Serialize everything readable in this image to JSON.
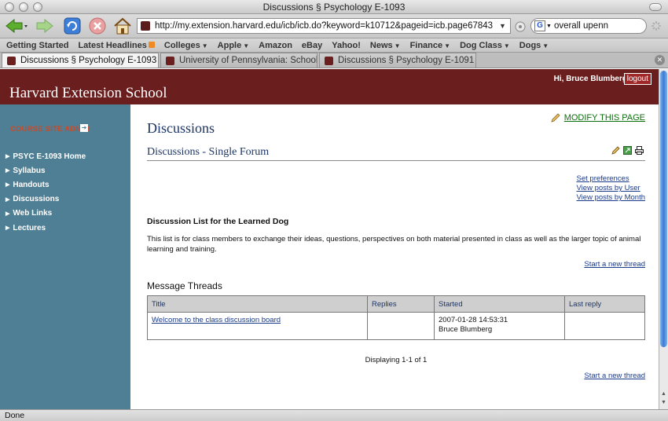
{
  "window": {
    "title": "Discussions § Psychology E-1093"
  },
  "navbar": {
    "url": "http://my.extension.harvard.edu/icb/icb.do?keyword=k10712&pageid=icb.page67843",
    "search_value": "overall upenn",
    "icons": [
      "back-icon",
      "forward-icon",
      "reload-icon",
      "stop-icon",
      "home-icon",
      "google-icon"
    ]
  },
  "bookmarks": [
    {
      "label": "Getting Started",
      "kind": "plain"
    },
    {
      "label": "Latest Headlines",
      "kind": "rss"
    },
    {
      "label": "Colleges",
      "kind": "menu"
    },
    {
      "label": "Apple",
      "kind": "menu"
    },
    {
      "label": "Amazon",
      "kind": "plain"
    },
    {
      "label": "eBay",
      "kind": "plain"
    },
    {
      "label": "Yahoo!",
      "kind": "plain"
    },
    {
      "label": "News",
      "kind": "menu"
    },
    {
      "label": "Finance",
      "kind": "menu"
    },
    {
      "label": "Dog Class",
      "kind": "menu"
    },
    {
      "label": "Dogs",
      "kind": "menu"
    }
  ],
  "tabs": [
    {
      "label": "Discussions § Psychology E-1093",
      "active": true
    },
    {
      "label": "University of Pennsylvania: School ...",
      "active": false
    },
    {
      "label": "Discussions § Psychology E-1091",
      "active": false
    }
  ],
  "header": {
    "school": "Harvard Extension School",
    "greeting": "Hi, Bruce Blumberg",
    "logout": "logout",
    "brand_color": "#6b1e1e"
  },
  "sidebar": {
    "admin_label": "COURSE SITE ADMIN",
    "items": [
      "PSYC E-1093 Home",
      "Syllabus",
      "Handouts",
      "Discussions",
      "Web Links",
      "Lectures"
    ],
    "color": "#4f7f94"
  },
  "main": {
    "title": "Discussions",
    "modify": "MODIFY THIS PAGE",
    "subtitle": "Discussions - Single Forum",
    "links": [
      "Set preferences",
      "View posts by User",
      "View posts by Month"
    ],
    "list_heading": "Discussion List for the Learned Dog",
    "description": "This list is for class members to exchange their ideas, questions, perspectives on both material presented in class as well as the larger topic of animal learning and training.",
    "new_thread": "Start a new thread",
    "threads_heading": "Message Threads",
    "columns": [
      "Title",
      "Replies",
      "Started",
      "Last reply"
    ],
    "rows": [
      {
        "title": "Welcome to the class discussion board",
        "replies": "",
        "started_date": "2007-01-28 14:53:31",
        "started_by": "Bruce Blumberg",
        "last_reply": ""
      }
    ],
    "displaying": "Displaying 1-1 of 1"
  },
  "status": {
    "text": "Done"
  }
}
